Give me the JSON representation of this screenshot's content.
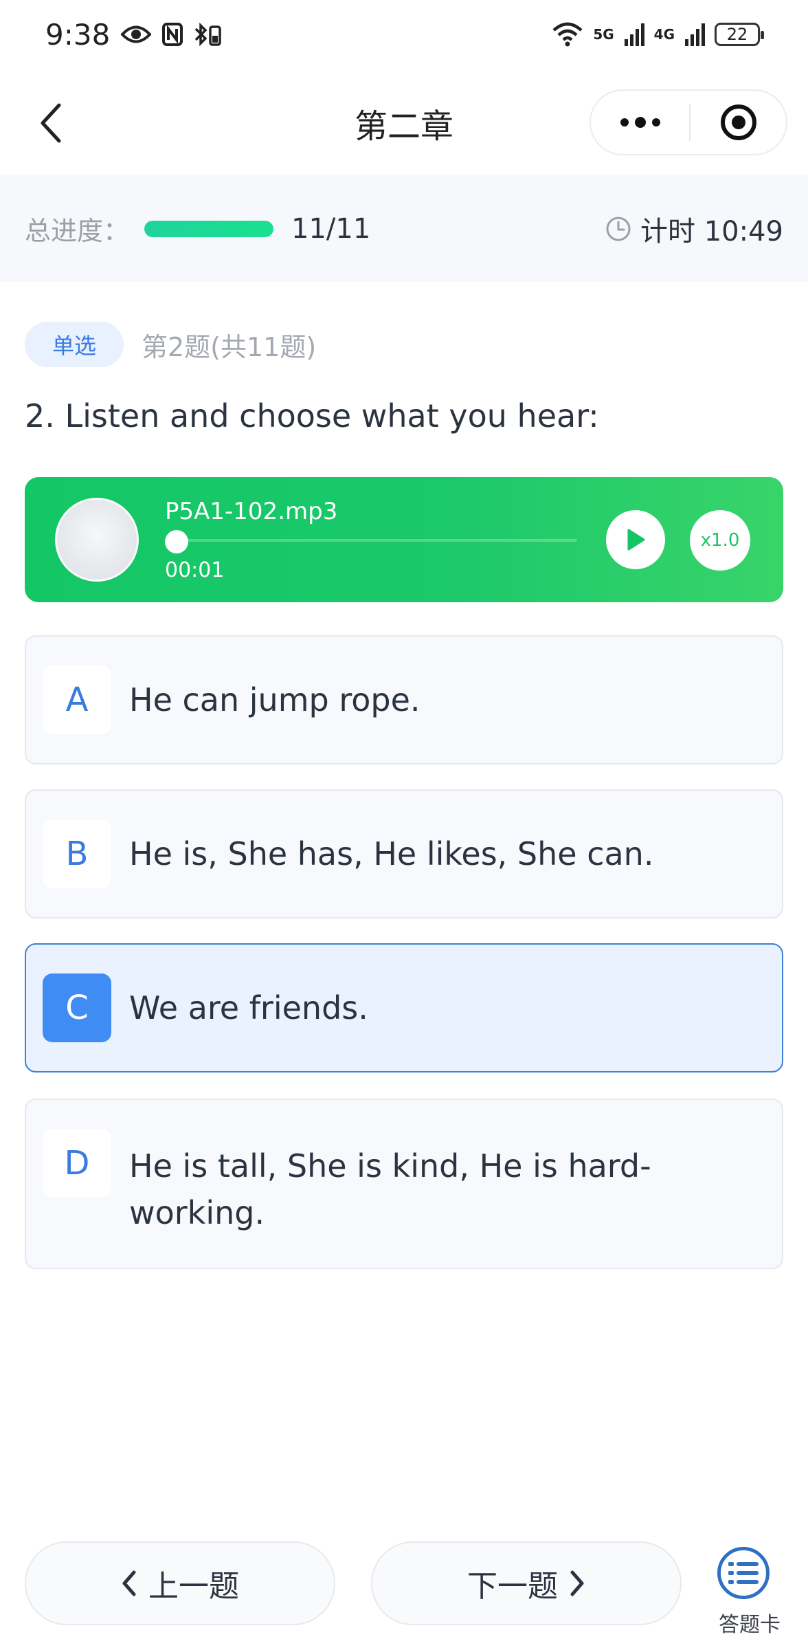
{
  "status_bar": {
    "time": "9:38",
    "net1": "5G",
    "net2": "4G",
    "battery": "22"
  },
  "nav": {
    "title": "第二章"
  },
  "progress": {
    "label": "总进度：",
    "count": "11/11",
    "fraction": 1.0,
    "timer": "计时 10:49"
  },
  "question": {
    "type_badge": "单选",
    "index_text": "第2题(共11题)",
    "text": "2. Listen and choose what you hear:"
  },
  "player": {
    "file_name": "P5A1-102.mp3",
    "time": "00:01",
    "speed": "x1.0"
  },
  "options": [
    {
      "letter": "A",
      "text": "He can jump rope."
    },
    {
      "letter": "B",
      "text": "He is, She has, He likes, She can."
    },
    {
      "letter": "C",
      "text": "We are friends."
    },
    {
      "letter": "D",
      "text": "He is tall, She is kind, He is hard-working."
    }
  ],
  "selected_option": "C",
  "bottom": {
    "prev_label": "上一题",
    "next_label": "下一题",
    "answer_sheet_label": "答题卡"
  },
  "colors": {
    "accent_blue": "#3f8cf5",
    "player_green": "#14c766",
    "progress_green": "#1fd49a"
  }
}
